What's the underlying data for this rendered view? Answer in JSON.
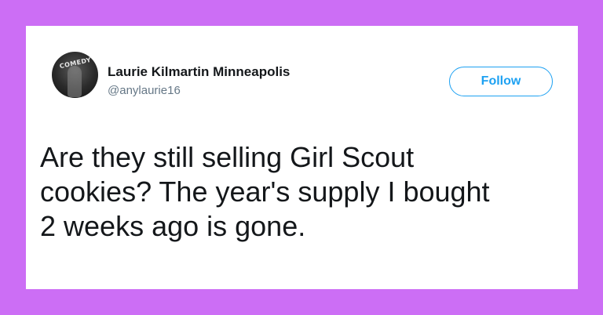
{
  "colors": {
    "background": "#cc6ef5",
    "card": "#ffffff",
    "accent": "#1da1f2",
    "text": "#14171a",
    "muted": "#657786"
  },
  "tweet": {
    "author": {
      "display_name": "Laurie Kilmartin Minneapolis",
      "handle": "@anylaurie16",
      "avatar_icon": "avatar-photo",
      "avatar_sign_text": "COMEDY"
    },
    "follow_label": "Follow",
    "text_lines": [
      "Are they still selling Girl Scout",
      "cookies? The year's supply I bought",
      "2 weeks ago is gone."
    ]
  }
}
